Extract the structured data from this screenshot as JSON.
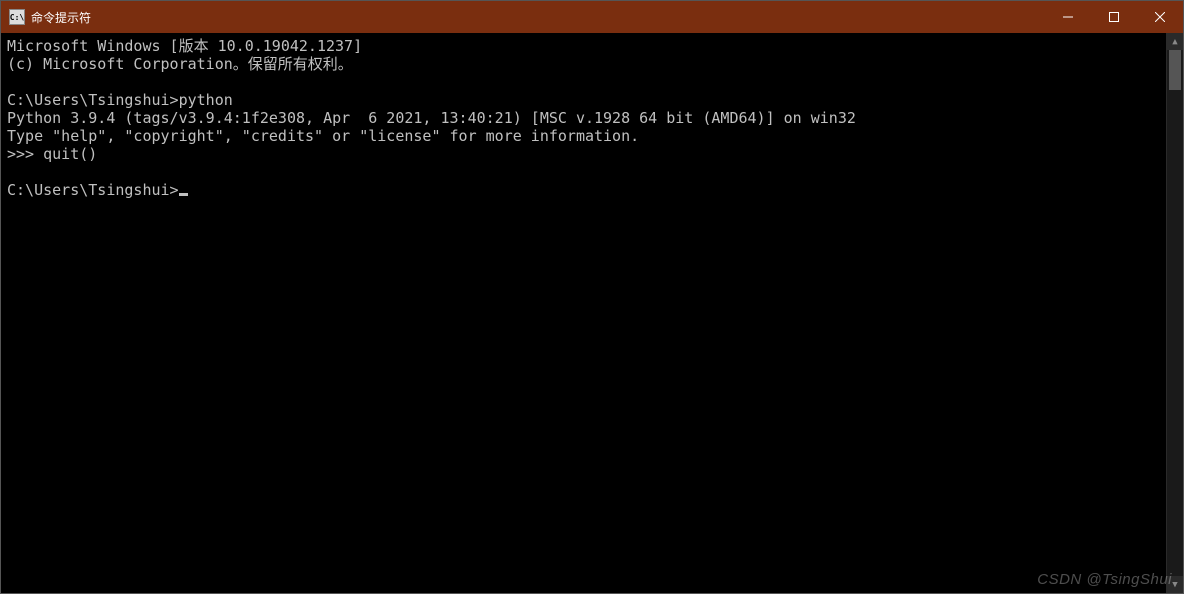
{
  "titlebar": {
    "icon_text": "C:\\",
    "title": "命令提示符"
  },
  "console": {
    "lines": [
      "Microsoft Windows [版本 10.0.19042.1237]",
      "(c) Microsoft Corporation。保留所有权利。",
      "",
      "C:\\Users\\Tsingshui>python",
      "Python 3.9.4 (tags/v3.9.4:1f2e308, Apr  6 2021, 13:40:21) [MSC v.1928 64 bit (AMD64)] on win32",
      "Type \"help\", \"copyright\", \"credits\" or \"license\" for more information.",
      ">>> quit()",
      "",
      "C:\\Users\\Tsingshui>"
    ]
  },
  "watermark": "CSDN @TsingShui"
}
